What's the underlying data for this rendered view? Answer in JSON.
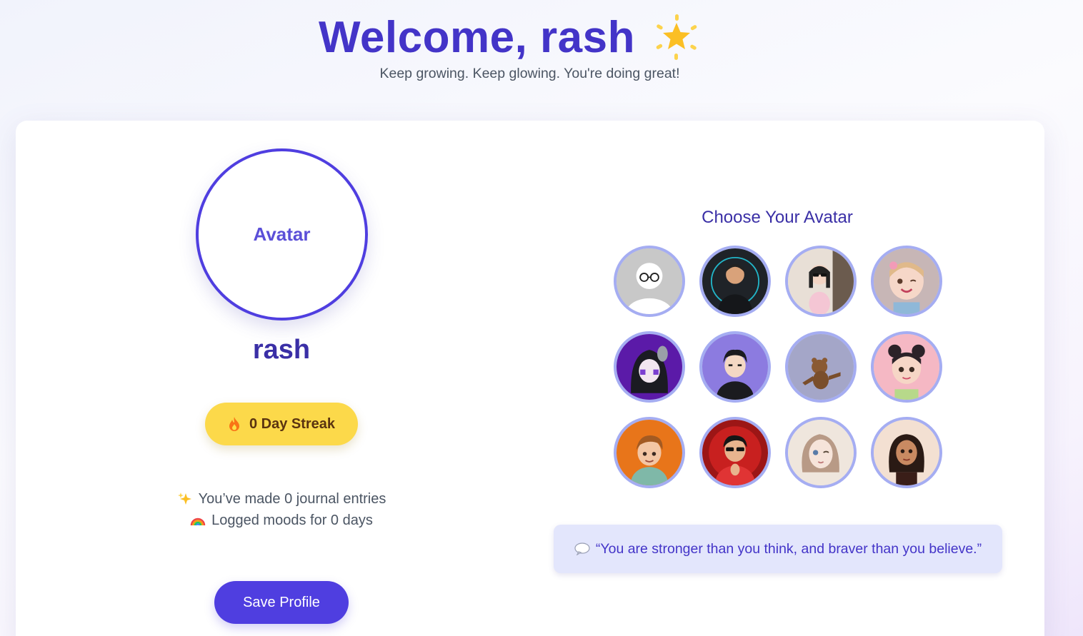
{
  "header": {
    "title": "Welcome, rash",
    "subtitle": "Keep growing. Keep glowing. You're doing great!",
    "title_icon": "glowing-star-icon"
  },
  "profile": {
    "avatar_placeholder": "Avatar",
    "username": "rash",
    "streak_label": "0 Day Streak",
    "streak_icon": "fire-icon",
    "stats": [
      {
        "icon": "sparkles-icon",
        "text": "You’ve made 0 journal entries"
      },
      {
        "icon": "rainbow-icon",
        "text": "Logged moods for 0 days"
      }
    ],
    "save_label": "Save Profile"
  },
  "avatar_picker": {
    "title": "Choose Your Avatar",
    "options": [
      "default-glasses-avatar",
      "boy-dark-shirt-avatar",
      "girl-sunglasses-avatar",
      "girl-pink-bow-avatar",
      "purple-hood-avatar",
      "boy-purple-bg-avatar",
      "bear-avatar",
      "girl-buns-avatar",
      "boy-orange-bg-avatar",
      "boy-red-shades-avatar",
      "girl-winking-avatar",
      "girl-dark-hair-avatar"
    ]
  },
  "quote": {
    "icon": "speech-bubble-icon",
    "text": "“You are stronger than you think, and braver than you believe.”"
  },
  "colors": {
    "primary": "#4f3ee0",
    "title": "#4334c8",
    "streak_bg": "#fcd94a",
    "avatar_ring": "#a5adf2",
    "quote_bg": "#e3e6fc"
  }
}
